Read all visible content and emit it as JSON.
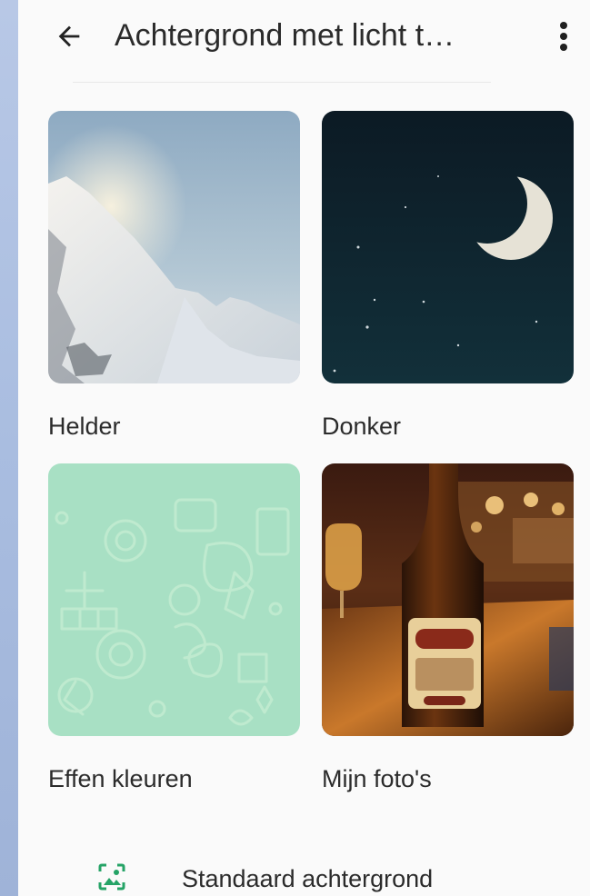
{
  "header": {
    "title": "Achtergrond met licht t…",
    "back_icon": "arrow-left-icon",
    "menu_icon": "more-vertical-icon"
  },
  "options": [
    {
      "label": "Helder",
      "image": "snowy-mountain-photo"
    },
    {
      "label": "Donker",
      "image": "crescent-moon-photo"
    },
    {
      "label": "Effen kleuren",
      "image": "green-doodle-pattern"
    },
    {
      "label": "Mijn foto's",
      "image": "beer-bottle-photo"
    }
  ],
  "default_option": {
    "label": "Standaard achtergrond",
    "icon": "wallpaper-icon"
  },
  "colors": {
    "accent": "#25a366",
    "pattern_bg": "#a8e0c4",
    "text": "#2b2b2b"
  }
}
